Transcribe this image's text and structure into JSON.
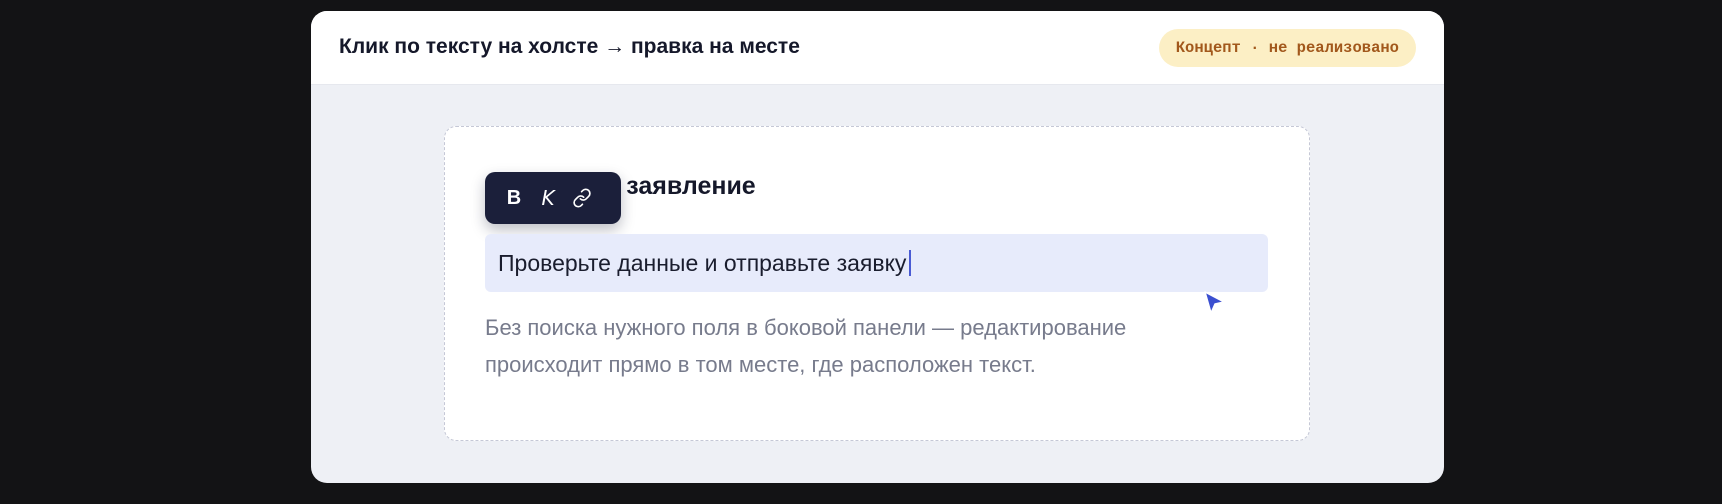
{
  "header": {
    "title": "Клик по тексту на холсте → правка на месте",
    "badge": "Концепт · не реализовано"
  },
  "canvas": {
    "heading": "Отправить заявление",
    "toolbar": {
      "bold_label": "B",
      "italic_label": "K",
      "link_icon": "link-icon"
    },
    "editing_text": "Проверьте данные и отправьте заявку",
    "description": "Без поиска нужного поля в боковой панели — редактирование происходит прямо в том месте, где расположен текст."
  },
  "colors": {
    "accent": "#3b4fd0",
    "badge_bg": "#fcefc5",
    "badge_text": "#a2581c",
    "edit_highlight": "#e7ebfb",
    "toolbar_bg": "#1b1f3a"
  }
}
